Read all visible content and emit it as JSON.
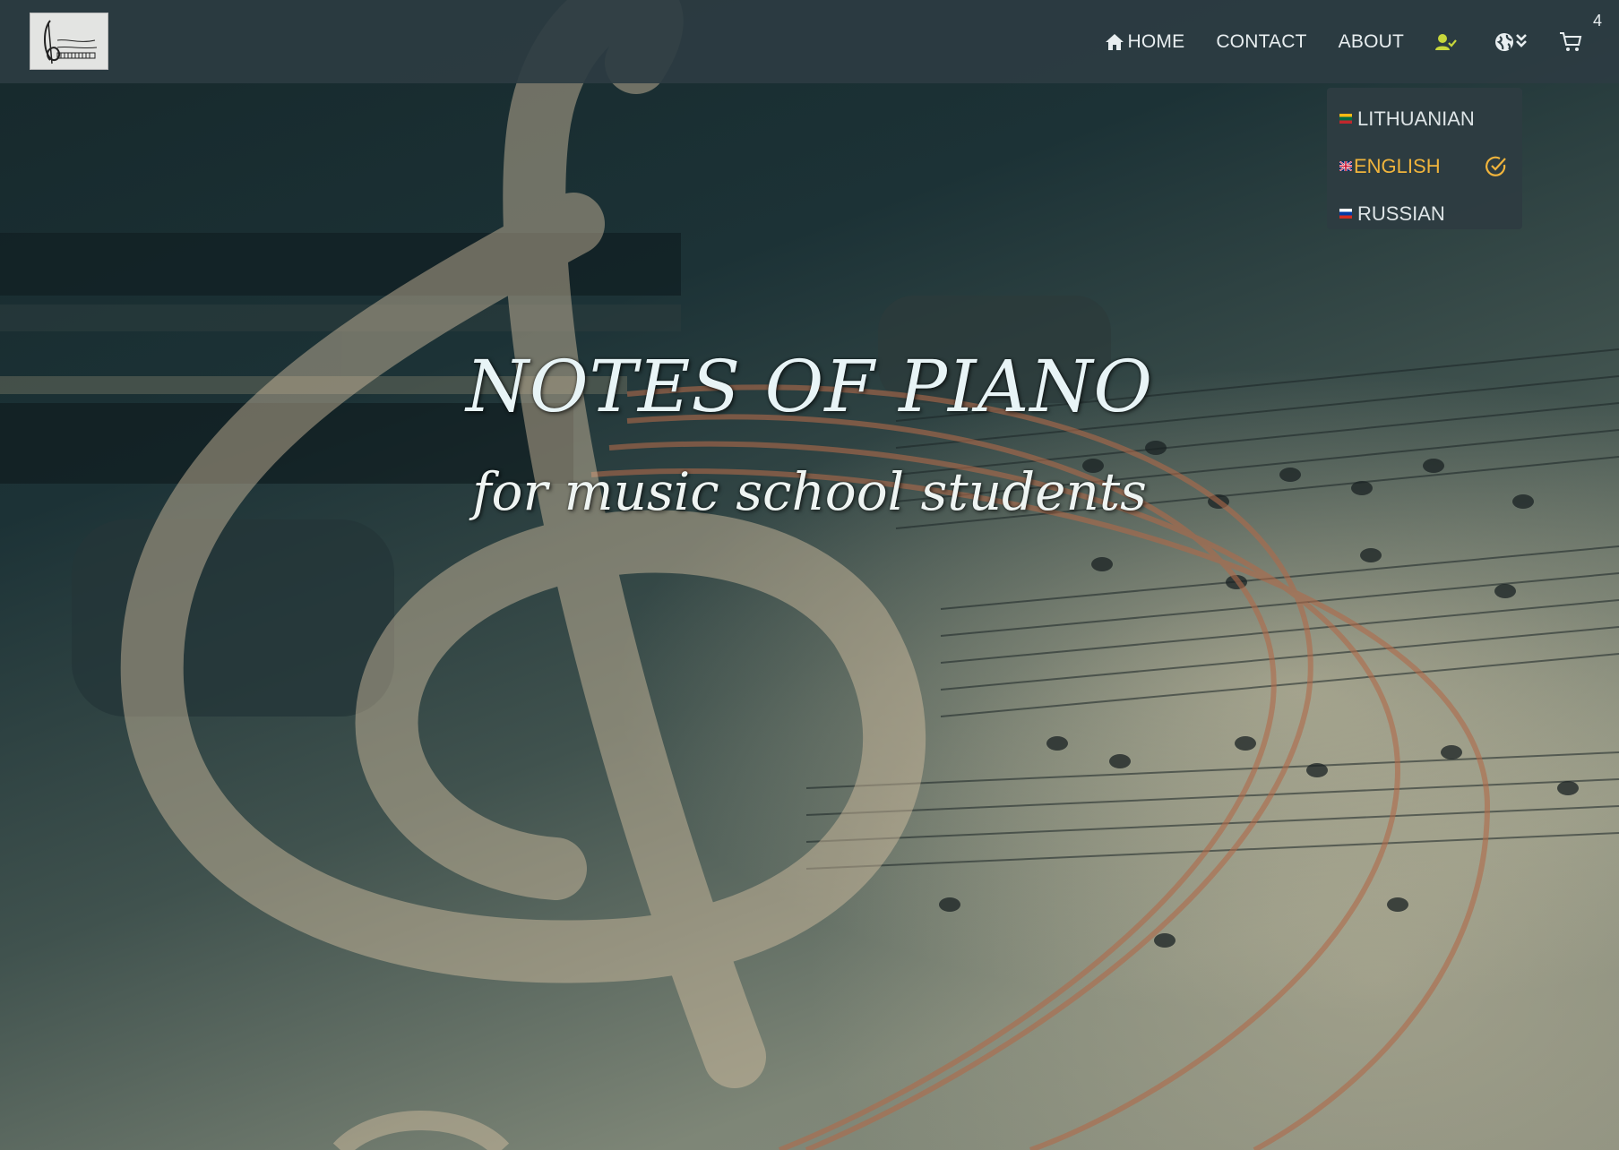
{
  "nav": {
    "home_label": "HOME",
    "contact_label": "CONTACT",
    "about_label": "ABOUT",
    "cart_count": "4",
    "icons": {
      "home": "home-icon",
      "user": "user-check-icon",
      "language": "globe-icon",
      "cart": "cart-icon"
    }
  },
  "language_menu": {
    "items": [
      {
        "label": "LITHUANIAN",
        "flag": "lt-flag-icon",
        "selected": false
      },
      {
        "label": "ENGLISH",
        "flag": "gb-flag-icon",
        "selected": true
      },
      {
        "label": "RUSSIAN",
        "flag": "ru-flag-icon",
        "selected": false
      }
    ]
  },
  "hero": {
    "title": "NOTES OF PIANO",
    "subtitle": "for music school students"
  },
  "colors": {
    "navbar": "#2c3c42",
    "nav_text": "#e8eef0",
    "active_language": "#f0b43c",
    "user_icon": "#c7d63b",
    "hero_text": "#e8f4f6"
  }
}
